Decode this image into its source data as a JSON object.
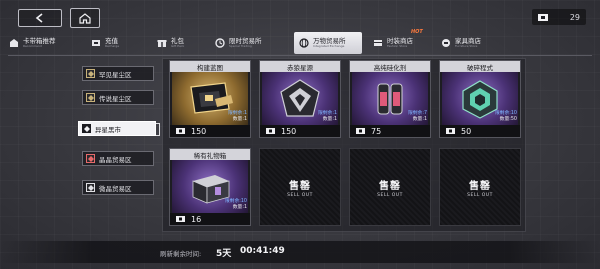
{
  "header": {
    "currency_value": "29"
  },
  "tabs": [
    {
      "label": "卡带箱推荐",
      "sub": "Recommend",
      "icon": "gift-set-icon"
    },
    {
      "label": "充值",
      "sub": "Recharge",
      "icon": "recharge-icon"
    },
    {
      "label": "礼包",
      "sub": "Gift Pack",
      "icon": "gift-icon"
    },
    {
      "label": "限时贸易所",
      "sub": "Special Trading",
      "icon": "clock-icon"
    },
    {
      "label": "万物贸易所",
      "sub": "Integrated Exchange",
      "icon": "globe-icon",
      "active": true
    },
    {
      "label": "时装商店",
      "sub": "Fashion Store",
      "icon": "fashion-icon",
      "hot": "HOT"
    },
    {
      "label": "家具商店",
      "sub": "Furniture Store",
      "icon": "sofa-icon"
    }
  ],
  "side_menu": [
    {
      "label": "罕见星尘区"
    },
    {
      "label": "传说星尘区"
    },
    {
      "label": "异星黑市",
      "active": true
    },
    {
      "label": "晶晶贸易区"
    },
    {
      "label": "微晶贸易区"
    }
  ],
  "items": [
    {
      "name": "构建蓝图",
      "limit": "限剩余:1",
      "qty": "数量:1",
      "price": "150",
      "art": "gold",
      "icon": "blueprint-icon"
    },
    {
      "name": "赤狼星源",
      "limit": "限剩余:1",
      "qty": "数量:1",
      "price": "150",
      "art": "purple",
      "icon": "wolf-emblem-icon"
    },
    {
      "name": "高纯硅化剂",
      "limit": "限剩余:7",
      "qty": "数量:1",
      "price": "75",
      "art": "purple",
      "icon": "canister-icon"
    },
    {
      "name": "破碎程式",
      "limit": "限剩余:10",
      "qty": "数量:50",
      "price": "50",
      "art": "purple",
      "icon": "broken-chip-icon"
    },
    {
      "name": "稀有礼物箱",
      "limit": "限剩余:10",
      "qty": "数量:1",
      "price": "16",
      "art": "purple",
      "icon": "gift-box-icon"
    }
  ],
  "soldout": {
    "main": "售罄",
    "sub": "SELL OUT"
  },
  "footer": {
    "refresh_label": "刷新剩余时间:",
    "days": "5天",
    "time": "00:41:49"
  },
  "colors": {
    "active_tab": "#e8e8ec",
    "hot": "#ff7a3d",
    "limit_text": "#7fb4ff",
    "gold_art": "#c9a25a",
    "purple_art": "#6a4a9a"
  }
}
